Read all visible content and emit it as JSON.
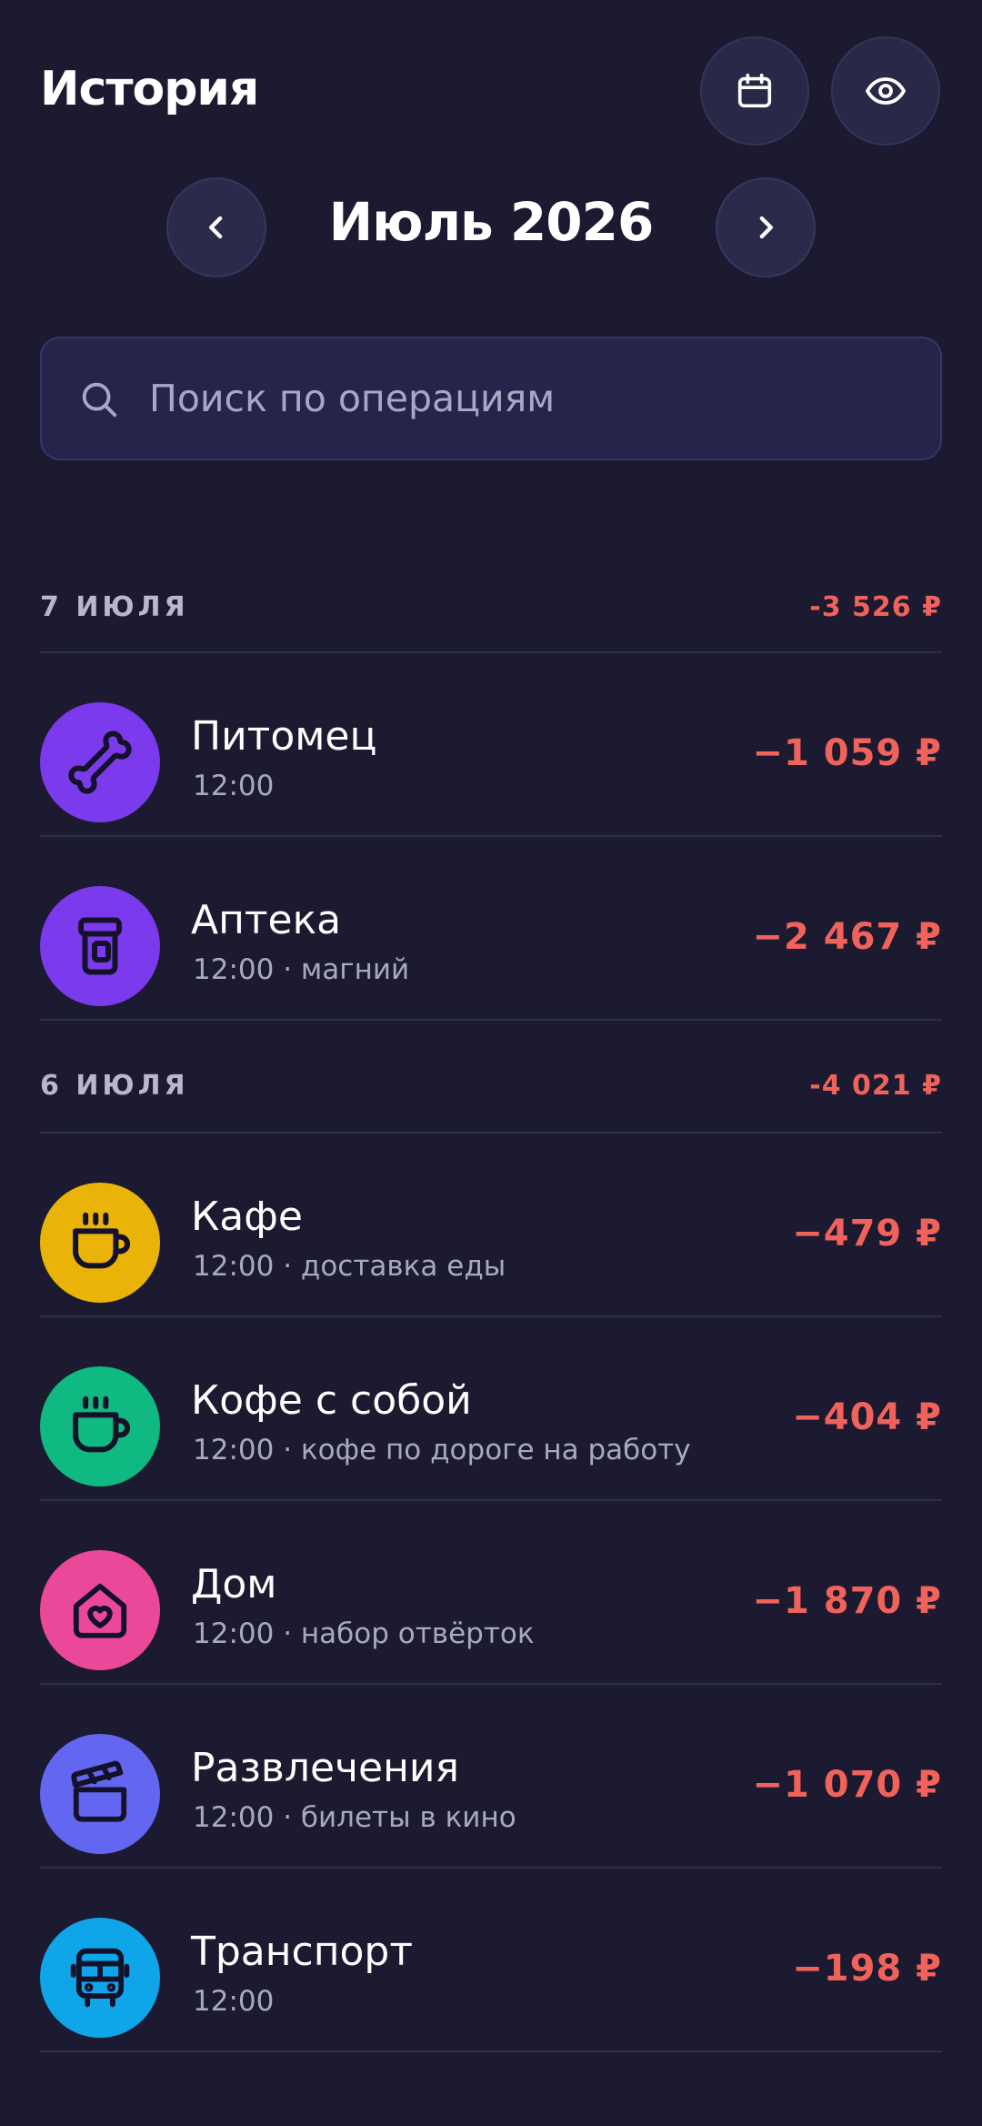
{
  "header": {
    "title": "История"
  },
  "month_nav": {
    "title": "Июль 2026"
  },
  "search": {
    "placeholder": "Поиск по операциям",
    "value": ""
  },
  "colors": {
    "background": "#1c1a31",
    "negative_amount": "#f0625a"
  },
  "days": [
    {
      "label": "7 ИЮЛЯ",
      "total": "-3 526 ₽",
      "transactions": [
        {
          "icon": "bone-icon",
          "icon_color": "#7c3aed",
          "name": "Питомец",
          "time": "12:00",
          "note": "",
          "amount": "−1 059 ₽"
        },
        {
          "icon": "pill-bottle-icon",
          "icon_color": "#7c3aed",
          "name": "Аптека",
          "time": "12:00",
          "note": "магний",
          "amount": "−2 467 ₽"
        }
      ]
    },
    {
      "label": "6 ИЮЛЯ",
      "total": "-4 021 ₽",
      "transactions": [
        {
          "icon": "coffee-cup-icon",
          "icon_color": "#eab308",
          "name": "Кафе",
          "time": "12:00",
          "note": "доставка еды",
          "amount": "−479 ₽"
        },
        {
          "icon": "coffee-cup-icon",
          "icon_color": "#10b981",
          "name": "Кофе с собой",
          "time": "12:00",
          "note": "кофе по дороге на работу",
          "amount": "−404 ₽"
        },
        {
          "icon": "house-heart-icon",
          "icon_color": "#ec4899",
          "name": "Дом",
          "time": "12:00",
          "note": "набор отвёрток",
          "amount": "−1 870 ₽"
        },
        {
          "icon": "clapperboard-icon",
          "icon_color": "#6366f1",
          "name": "Развлечения",
          "time": "12:00",
          "note": "билеты в кино",
          "amount": "−1 070 ₽"
        },
        {
          "icon": "bus-icon",
          "icon_color": "#0ea5e9",
          "name": "Транспорт",
          "time": "12:00",
          "note": "",
          "amount": "−198 ₽"
        }
      ]
    }
  ]
}
